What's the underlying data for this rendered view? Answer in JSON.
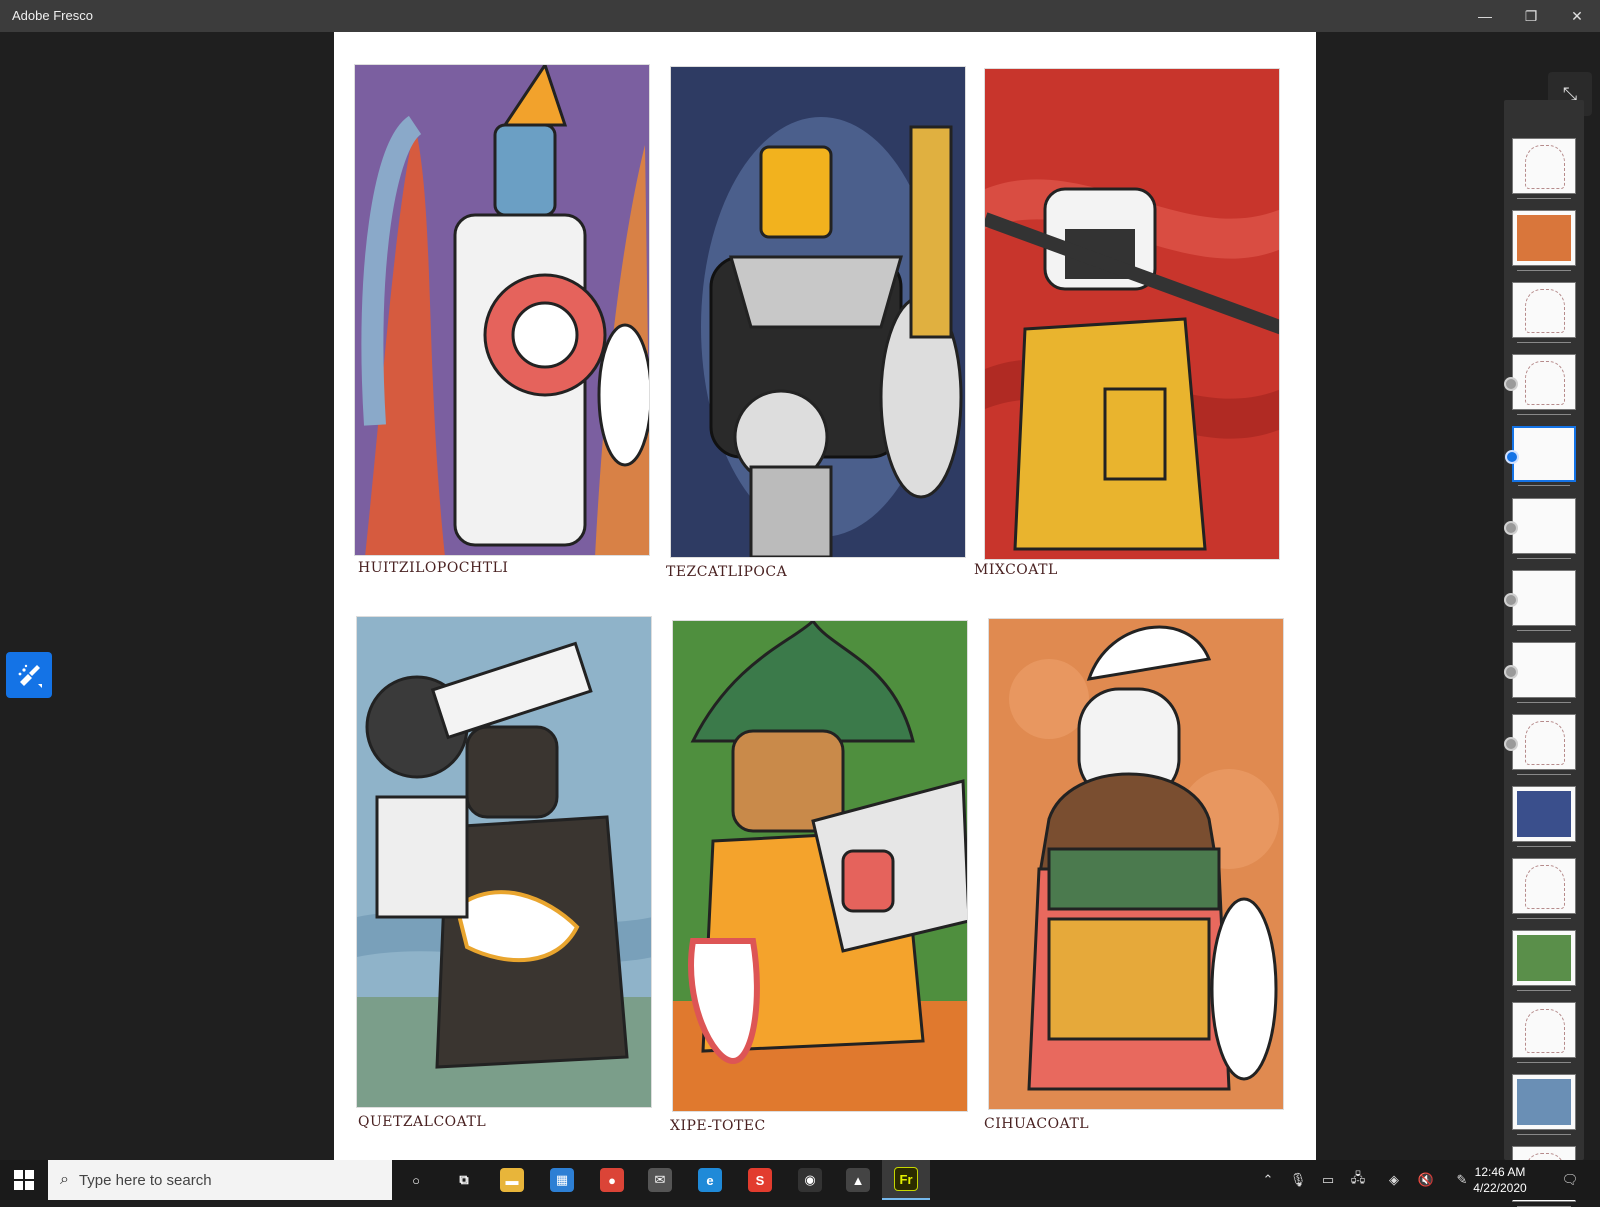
{
  "window": {
    "title": "Adobe Fresco",
    "minimize_glyph": "—",
    "maximize_glyph": "❐",
    "close_glyph": "✕"
  },
  "canvas": {
    "captions": [
      "HUITZILOPOCHTLI",
      "TEZCATLIPOCA",
      "MIXCOATL",
      "QUETZALCOATL",
      "XIPE-TOTEC",
      "CIHUACOATL"
    ]
  },
  "tools": {
    "brush_icon": "pixel-brush-icon"
  },
  "focus_button": {
    "icon": "collapse-arrows-icon",
    "glyph": "⤡"
  },
  "layers": {
    "items": [
      {
        "type": "sketch",
        "dot": false,
        "active": false
      },
      {
        "type": "color",
        "dot": false,
        "active": false,
        "color": "#d9763b"
      },
      {
        "type": "sketch",
        "dot": false,
        "active": false
      },
      {
        "type": "sketch",
        "dot": true,
        "active": false
      },
      {
        "type": "empty",
        "dot": true,
        "active": true
      },
      {
        "type": "empty",
        "dot": true,
        "active": false
      },
      {
        "type": "empty",
        "dot": true,
        "active": false
      },
      {
        "type": "empty",
        "dot": true,
        "active": false
      },
      {
        "type": "sketch",
        "dot": true,
        "active": false
      },
      {
        "type": "color",
        "dot": false,
        "active": false,
        "color": "#3a4f8c"
      },
      {
        "type": "sketch",
        "dot": false,
        "active": false
      },
      {
        "type": "color",
        "dot": false,
        "active": false,
        "color": "#5a8f4a"
      },
      {
        "type": "sketch",
        "dot": false,
        "active": false
      },
      {
        "type": "color",
        "dot": false,
        "active": false,
        "color": "#6a8fb5"
      },
      {
        "type": "sketch",
        "dot": false,
        "active": false
      }
    ]
  },
  "taskbar": {
    "search_placeholder": "Type here to search",
    "apps": [
      {
        "name": "cortana",
        "glyph": "○",
        "color": "transparent"
      },
      {
        "name": "task-view",
        "glyph": "⧉",
        "color": "transparent"
      },
      {
        "name": "file-explorer",
        "glyph": "▬",
        "color": "#e8b53a"
      },
      {
        "name": "microsoft-store",
        "glyph": "▦",
        "color": "#2d7fd4"
      },
      {
        "name": "chrome",
        "glyph": "●",
        "color": "#db4437"
      },
      {
        "name": "mail",
        "glyph": "✉",
        "color": "#555555"
      },
      {
        "name": "edge",
        "glyph": "e",
        "color": "#1f8ad8"
      },
      {
        "name": "sketchbook",
        "glyph": "S",
        "color": "#e23c2e"
      },
      {
        "name": "obs",
        "glyph": "◉",
        "color": "#333333"
      },
      {
        "name": "photos",
        "glyph": "▲",
        "color": "#444444"
      },
      {
        "name": "fresco",
        "glyph": "Fr",
        "color": "#2b2b00"
      }
    ],
    "clock_time": "12:46 AM",
    "clock_date": "4/22/2020"
  }
}
